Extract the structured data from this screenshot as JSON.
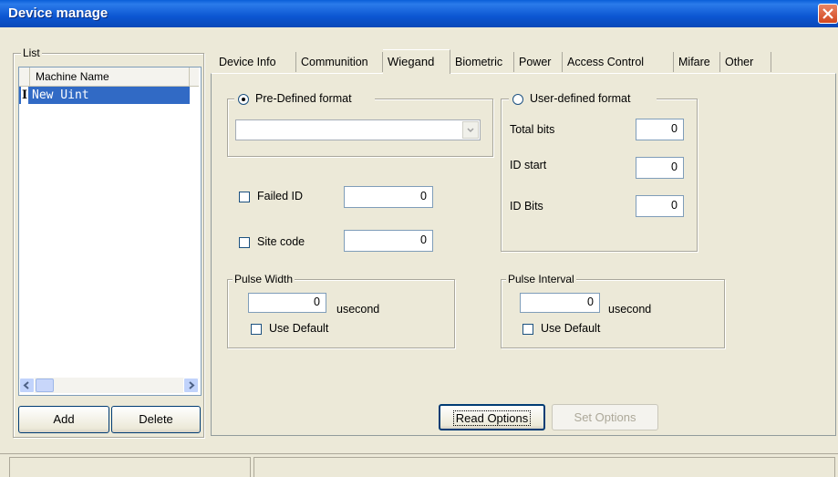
{
  "window": {
    "title": "Device manage"
  },
  "list": {
    "legend": "List",
    "column_header": "Machine Name",
    "rows": [
      {
        "marker": "I",
        "name": "New Uint"
      }
    ]
  },
  "buttons": {
    "add": "Add",
    "delete": "Delete",
    "read_options": "Read Options",
    "set_options": "Set Options"
  },
  "tabs": [
    {
      "label": "Device Info",
      "active": false
    },
    {
      "label": "Communition",
      "active": false
    },
    {
      "label": "Wiegand",
      "active": true
    },
    {
      "label": "Biometric",
      "active": false
    },
    {
      "label": "Power",
      "active": false
    },
    {
      "label": "Access Control",
      "active": false
    },
    {
      "label": "Mifare",
      "active": false
    },
    {
      "label": "Other",
      "active": false
    }
  ],
  "wiegand": {
    "predefined": {
      "label": "Pre-Defined format",
      "selected": true,
      "combo_value": ""
    },
    "userdefined": {
      "label": "User-defined format",
      "selected": false,
      "total_bits_label": "Total bits",
      "total_bits": "0",
      "id_start_label": "ID start",
      "id_start": "0",
      "id_bits_label": "ID Bits",
      "id_bits": "0"
    },
    "failed_id": {
      "label": "Failed ID",
      "checked": false,
      "value": "0"
    },
    "site_code": {
      "label": "Site code",
      "checked": false,
      "value": "0"
    },
    "pulse_width": {
      "legend": "Pulse Width",
      "value": "0",
      "unit": "usecond",
      "use_default_label": "Use Default",
      "use_default": false
    },
    "pulse_interval": {
      "legend": "Pulse Interval",
      "value": "0",
      "unit": "usecond",
      "use_default_label": "Use Default",
      "use_default": false
    }
  },
  "colors": {
    "title_bar": "#0a5fd8",
    "selection": "#316ac5",
    "face": "#ece9d8"
  }
}
